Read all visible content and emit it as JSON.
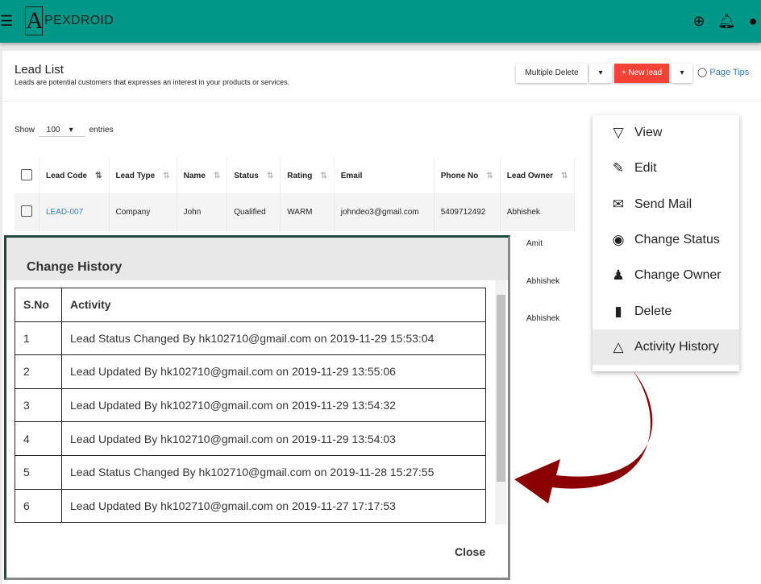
{
  "header": {
    "logo_letter": "A",
    "logo_rest": "PEXDROID"
  },
  "page": {
    "title": "Lead List",
    "subtitle": "Leads are potential customers that expresses an interest in your products or services.",
    "multiple_delete": "Multiple Delete",
    "new_lead": "+ New lead",
    "page_tips": "Page Tips",
    "show_label": "Show",
    "entries_value": "100",
    "entries_label": "entries"
  },
  "table": {
    "columns": [
      "Lead Code",
      "Lead Type",
      "Name",
      "Status",
      "Rating",
      "Email",
      "Phone No",
      "Lead Owner"
    ],
    "row": {
      "code": "LEAD-007",
      "type": "Company",
      "name": "John",
      "status": "Qualified",
      "rating": "WARM",
      "email": "johndeo3@gmail.com",
      "phone": "5409712492",
      "owner": "Abhishek"
    },
    "other_owners": [
      "Amit",
      "Abhishek",
      "Abhishek"
    ]
  },
  "menu": {
    "items": [
      {
        "label": "View",
        "icon": "triangle-down-icon"
      },
      {
        "label": "Edit",
        "icon": "pencil-icon"
      },
      {
        "label": "Send Mail",
        "icon": "mail-icon"
      },
      {
        "label": "Change Status",
        "icon": "status-icon"
      },
      {
        "label": "Change Owner",
        "icon": "people-icon"
      },
      {
        "label": "Delete",
        "icon": "trash-icon"
      },
      {
        "label": "Activity History",
        "icon": "triangle-up-icon"
      }
    ]
  },
  "modal": {
    "title": "Change History",
    "col_sno": "S.No",
    "col_activity": "Activity",
    "close": "Close",
    "rows": [
      {
        "n": "1",
        "a": "Lead Status Changed By hk102710@gmail.com on 2019-11-29 15:53:04"
      },
      {
        "n": "2",
        "a": "Lead Updated By hk102710@gmail.com on 2019-11-29 13:55:06"
      },
      {
        "n": "3",
        "a": "Lead Updated By hk102710@gmail.com on 2019-11-29 13:54:32"
      },
      {
        "n": "4",
        "a": "Lead Updated By hk102710@gmail.com on 2019-11-29 13:54:03"
      },
      {
        "n": "5",
        "a": "Lead Status Changed By hk102710@gmail.com on 2019-11-28 15:27:55"
      },
      {
        "n": "6",
        "a": "Lead Updated By hk102710@gmail.com on 2019-11-27 17:17:53"
      }
    ]
  },
  "colors": {
    "brand": "#009688",
    "new_lead": "#f44336",
    "arrow": "#8b0000"
  }
}
